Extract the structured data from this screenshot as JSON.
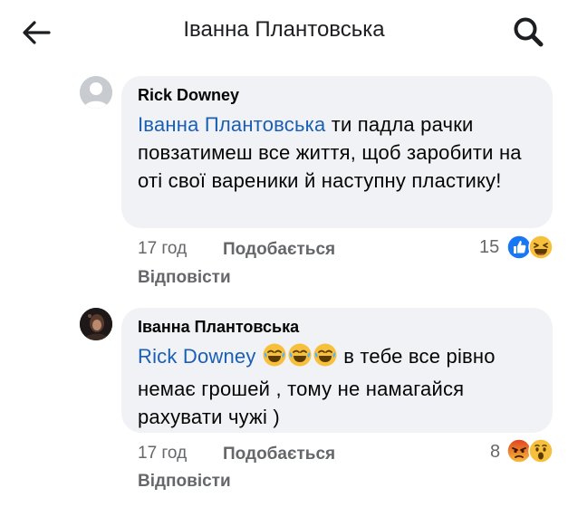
{
  "header": {
    "title": "Іванна Плантовська"
  },
  "comments": [
    {
      "author": "Rick Downey",
      "mention": "Іванна Плантовська",
      "text": " ти падла рачки повзатимеш все життя, щоб заробити на оті свої вареники й наступну пластику!",
      "time": "17 год",
      "like": "Подобається",
      "reply": "Відповісти",
      "reaction_count": "15",
      "reactions": [
        "like-icon",
        "haha-icon"
      ]
    },
    {
      "author": "Іванна Плантовська",
      "mention": "Rick Downey",
      "text_after_emoji": " в тебе все рівно немає грошей , тому не намагайся рахувати чужі )",
      "inline_emoji": [
        "joy-emoji",
        "joy-emoji",
        "joy-emoji"
      ],
      "time": "17 год",
      "like": "Подобається",
      "reply": "Відповісти",
      "reaction_count": "8",
      "reactions": [
        "angry-icon",
        "wow-icon"
      ]
    }
  ],
  "colors": {
    "bubble": "#f0f2f5",
    "mention": "#1a5fb4",
    "meta": "#65676b",
    "like_blue": "#1877f2",
    "emoji_yellow": "#f7c03c",
    "angry_red": "#e9710f"
  }
}
